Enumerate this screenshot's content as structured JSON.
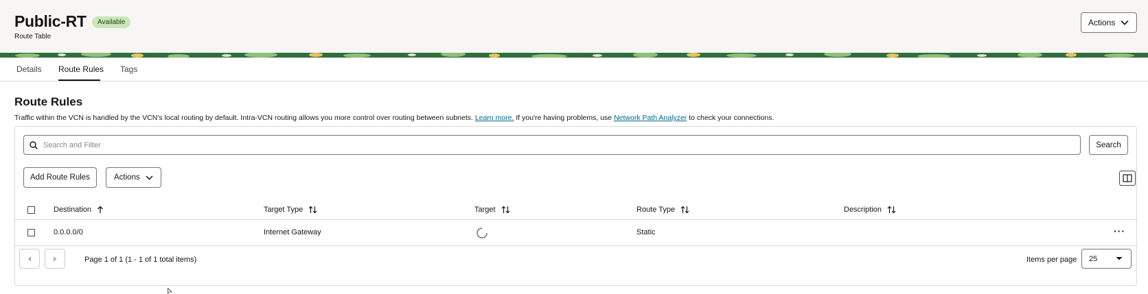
{
  "header": {
    "title": "Public-RT",
    "status": "Available",
    "subtitle": "Route Table",
    "actions_label": "Actions"
  },
  "tabs": [
    {
      "label": "Details"
    },
    {
      "label": "Route Rules"
    },
    {
      "label": "Tags"
    }
  ],
  "section": {
    "title": "Route Rules",
    "desc_1": "Traffic within the VCN is handled by the VCN's local routing by default. Intra-VCN routing allows you more control over routing between subnets.",
    "learn_more": "Learn more.",
    "desc_2": "If you're having problems, use",
    "network_path_analyzer": "Network Path Analyzer",
    "desc_3": "to check your connections."
  },
  "search": {
    "placeholder": "Search and Filter",
    "button_label": "Search"
  },
  "toolbar": {
    "add_label": "Add Route Rules",
    "actions_label": "Actions"
  },
  "table": {
    "columns": [
      "Destination",
      "Target Type",
      "Target",
      "Route Type",
      "Description"
    ],
    "rows": [
      {
        "destination": "0.0.0.0/0",
        "target_type": "Internet Gateway",
        "target_state": "loading",
        "route_type": "Static",
        "description": ""
      }
    ]
  },
  "pagination": {
    "info": "Page 1 of 1 (1 - 1 of 1 total items)",
    "items_per_page_label": "Items per page",
    "items_per_page": "25"
  },
  "colors": {
    "badge_bg": "#c9e7b8",
    "link": "#00688c",
    "banner_green": "#2f6f3e"
  }
}
